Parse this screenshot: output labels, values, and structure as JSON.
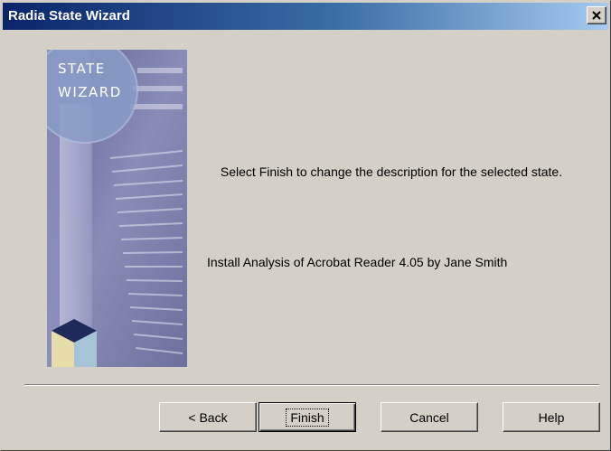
{
  "window": {
    "title": "Radia State Wizard"
  },
  "banner": {
    "line1": "STATE",
    "line2": "WIZARD"
  },
  "message": {
    "instruction": "Select Finish to change the description for the selected state.",
    "state_description": "Install Analysis of Acrobat Reader 4.05 by Jane Smith"
  },
  "buttons": {
    "back": "< Back",
    "finish": "Finish",
    "cancel": "Cancel",
    "help": "Help"
  },
  "colors": {
    "titlebar": "#0a246a",
    "dialog": "#d4d0c8",
    "banner": "#6b6d98"
  }
}
